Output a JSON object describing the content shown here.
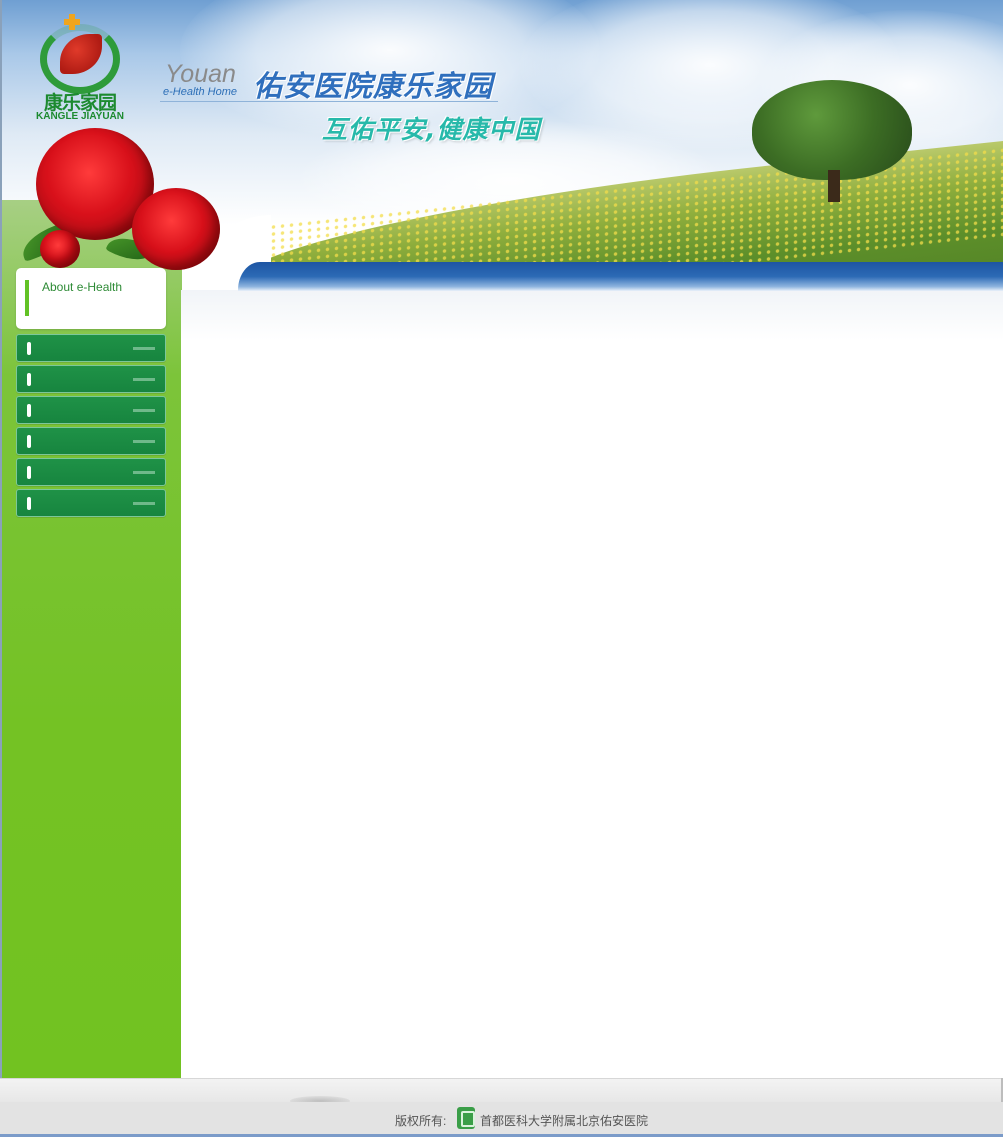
{
  "header": {
    "logo_text_cn": "康乐家园",
    "logo_text_en": "KANGLE JIAYUAN",
    "title_en": "Youan",
    "title_en_sub": "e-Health Home",
    "title_cn": "佑安医院康乐家园",
    "slogan": "互佑平安,健康中国"
  },
  "sidebar": {
    "about_label": "About e-Health",
    "items": [
      {
        "label": ""
      },
      {
        "label": ""
      },
      {
        "label": ""
      },
      {
        "label": ""
      },
      {
        "label": ""
      },
      {
        "label": ""
      }
    ]
  },
  "footer": {
    "copyright_prefix": "版权所有:",
    "hospital_name": "首都医科大学附属北京佑安医院"
  },
  "colors": {
    "sidebar_green": "#72c221",
    "menu_green": "#1b8a43",
    "banner_blue": "#1d55a3",
    "slogan_teal": "#27b9aa"
  }
}
